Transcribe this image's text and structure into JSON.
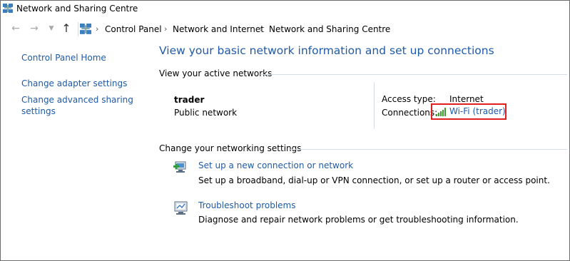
{
  "window": {
    "title": "Network and Sharing Centre",
    "app_icon": "network-icon"
  },
  "address_bar": {
    "breadcrumbs": [
      "Control Panel",
      "Network and Internet",
      "Network and Sharing Centre"
    ]
  },
  "sidebar": {
    "items": [
      {
        "label": "Control Panel Home"
      },
      {
        "label": "Change adapter settings"
      },
      {
        "label": "Change advanced sharing settings"
      }
    ]
  },
  "main": {
    "title": "View your basic network information and set up connections",
    "active_networks": {
      "heading": "View your active networks",
      "network_name": "trader",
      "network_category": "Public network",
      "access_type_label": "Access type:",
      "access_type_value": "Internet",
      "connections_label": "Connections:",
      "connection_link": "Wi-Fi (trader)"
    },
    "settings": {
      "heading": "Change your networking settings",
      "tasks": [
        {
          "icon": "new-connection-icon",
          "link": "Set up a new connection or network",
          "description": "Set up a broadband, dial-up or VPN connection, or set up a router or access point."
        },
        {
          "icon": "troubleshoot-icon",
          "link": "Troubleshoot problems",
          "description": "Diagnose and repair network problems or get troubleshooting information."
        }
      ]
    }
  },
  "colors": {
    "link": "#1e5aa8",
    "highlight_box": "#e0201f",
    "signal": "#3a9a2a"
  }
}
